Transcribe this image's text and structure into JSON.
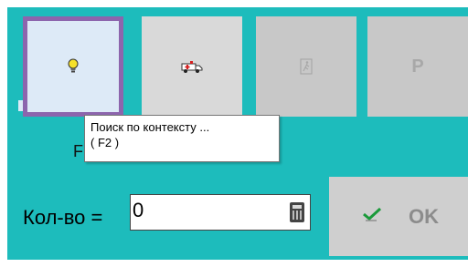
{
  "tiles": [
    {
      "icon": "lightbulb-icon",
      "state": "selected"
    },
    {
      "icon": "ambulance-icon",
      "state": "normal"
    },
    {
      "icon": "exit-door-icon",
      "state": "disabled"
    },
    {
      "label": "P",
      "state": "disabled"
    }
  ],
  "partial_label": "F",
  "tooltip": {
    "line1": "Поиск  по  контексту ...",
    "line2": "( F2 )"
  },
  "quantity": {
    "label": "Кол-во =",
    "value": "0",
    "calculator_icon": "calculator-icon"
  },
  "ok_button": {
    "label": "OK",
    "icon": "checkmark-icon"
  },
  "colors": {
    "panel": "#1dbcbc",
    "selected_border": "#8c65ad",
    "tile": "#d9d9d9"
  }
}
